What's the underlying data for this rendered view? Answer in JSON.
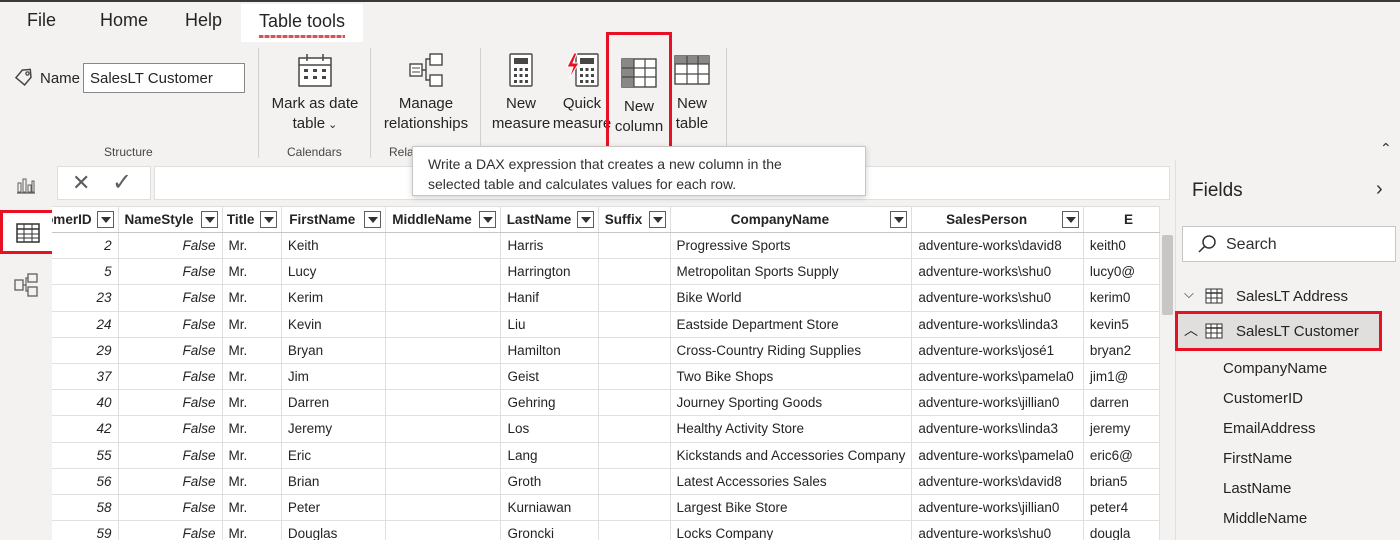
{
  "menu": {
    "file": "File",
    "home": "Home",
    "help": "Help",
    "table_tools": "Table tools"
  },
  "ribbon": {
    "name_label": "Name",
    "name_value": "SalesLT Customer",
    "mark_as_date": [
      "Mark as date",
      "table"
    ],
    "manage_rel": [
      "Manage",
      "relationships"
    ],
    "new_measure": [
      "New",
      "measure"
    ],
    "quick_measure": [
      "Quick",
      "measure"
    ],
    "new_column": [
      "New",
      "column"
    ],
    "new_table": [
      "New",
      "table"
    ],
    "groups": {
      "structure": "Structure",
      "calendars": "Calendars",
      "relationships": "Rela"
    }
  },
  "tooltip": {
    "line1": "Write a DAX expression that creates a new column in the",
    "line2": "selected table and calculates values for each row."
  },
  "fields": {
    "title": "Fields",
    "search_placeholder": "Search",
    "tables": [
      "SalesLT Address",
      "SalesLT Customer"
    ],
    "customer_fields": [
      "CompanyName",
      "CustomerID",
      "EmailAddress",
      "FirstName",
      "LastName",
      "MiddleName"
    ]
  },
  "grid": {
    "columns": [
      "omerID",
      "NameStyle",
      "Title",
      "FirstName",
      "MiddleName",
      "LastName",
      "Suffix",
      "CompanyName",
      "SalesPerson",
      "E"
    ],
    "rows": [
      [
        "2",
        "False",
        "Mr.",
        "Keith",
        "",
        "Harris",
        "",
        "Progressive Sports",
        "adventure-works\\david8",
        "keith0"
      ],
      [
        "5",
        "False",
        "Mr.",
        "Lucy",
        "",
        "Harrington",
        "",
        "Metropolitan Sports Supply",
        "adventure-works\\shu0",
        "lucy0@"
      ],
      [
        "23",
        "False",
        "Mr.",
        "Kerim",
        "",
        "Hanif",
        "",
        "Bike World",
        "adventure-works\\shu0",
        "kerim0"
      ],
      [
        "24",
        "False",
        "Mr.",
        "Kevin",
        "",
        "Liu",
        "",
        "Eastside Department Store",
        "adventure-works\\linda3",
        "kevin5"
      ],
      [
        "29",
        "False",
        "Mr.",
        "Bryan",
        "",
        "Hamilton",
        "",
        "Cross-Country Riding Supplies",
        "adventure-works\\josé1",
        "bryan2"
      ],
      [
        "37",
        "False",
        "Mr.",
        "Jim",
        "",
        "Geist",
        "",
        "Two Bike Shops",
        "adventure-works\\pamela0",
        "jim1@"
      ],
      [
        "40",
        "False",
        "Mr.",
        "Darren",
        "",
        "Gehring",
        "",
        "Journey Sporting Goods",
        "adventure-works\\jillian0",
        "darren"
      ],
      [
        "42",
        "False",
        "Mr.",
        "Jeremy",
        "",
        "Los",
        "",
        "Healthy Activity Store",
        "adventure-works\\linda3",
        "jeremy"
      ],
      [
        "55",
        "False",
        "Mr.",
        "Eric",
        "",
        "Lang",
        "",
        "Kickstands and Accessories Company",
        "adventure-works\\pamela0",
        "eric6@"
      ],
      [
        "56",
        "False",
        "Mr.",
        "Brian",
        "",
        "Groth",
        "",
        "Latest Accessories Sales",
        "adventure-works\\david8",
        "brian5"
      ],
      [
        "58",
        "False",
        "Mr.",
        "Peter",
        "",
        "Kurniawan",
        "",
        "Largest Bike Store",
        "adventure-works\\jillian0",
        "peter4"
      ],
      [
        "59",
        "False",
        "Mr.",
        "Douglas",
        "",
        "Groncki",
        "",
        "Locks Company",
        "adventure-works\\shu0",
        "dougla"
      ]
    ]
  }
}
